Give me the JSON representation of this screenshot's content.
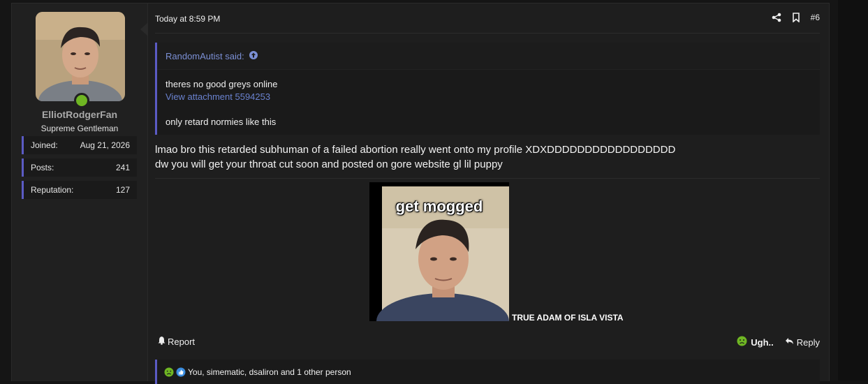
{
  "post": {
    "timestamp": "Today at 8:59 PM",
    "post_number": "#6",
    "author": {
      "name": "ElliotRodgerFan",
      "title": "Supreme Gentleman",
      "online": true,
      "stats": [
        {
          "label": "Joined:",
          "value": "Aug 21, 2026"
        },
        {
          "label": "Posts:",
          "value": "241"
        },
        {
          "label": "Reputation:",
          "value": "127"
        }
      ]
    },
    "quote": {
      "author_said": "RandomAutist said:",
      "line1": "theres no good greys online",
      "attachment_link": "View attachment 5594253",
      "line2": "only retard normies like this"
    },
    "body": {
      "line1": "lmao bro this retarded subhuman of a failed abortion really went onto my profile XDXDDDDDDDDDDDDDDDDD",
      "line2": "dw you will get your throat cut soon and posted on gore website gl lil puppy"
    },
    "image": {
      "caption": "get mogged",
      "trailing_text": "TRUE ADAM OF ISLA VISTA"
    },
    "actions": {
      "report": "Report",
      "reaction": "Ugh..",
      "reply": "Reply"
    },
    "reactions_summary": "You, simematic, dsaliron and 1 other person"
  },
  "colors": {
    "accent": "#5b5bc4",
    "link": "#6a82cf",
    "online": "#6fb623",
    "background": "#1e1e1e"
  }
}
